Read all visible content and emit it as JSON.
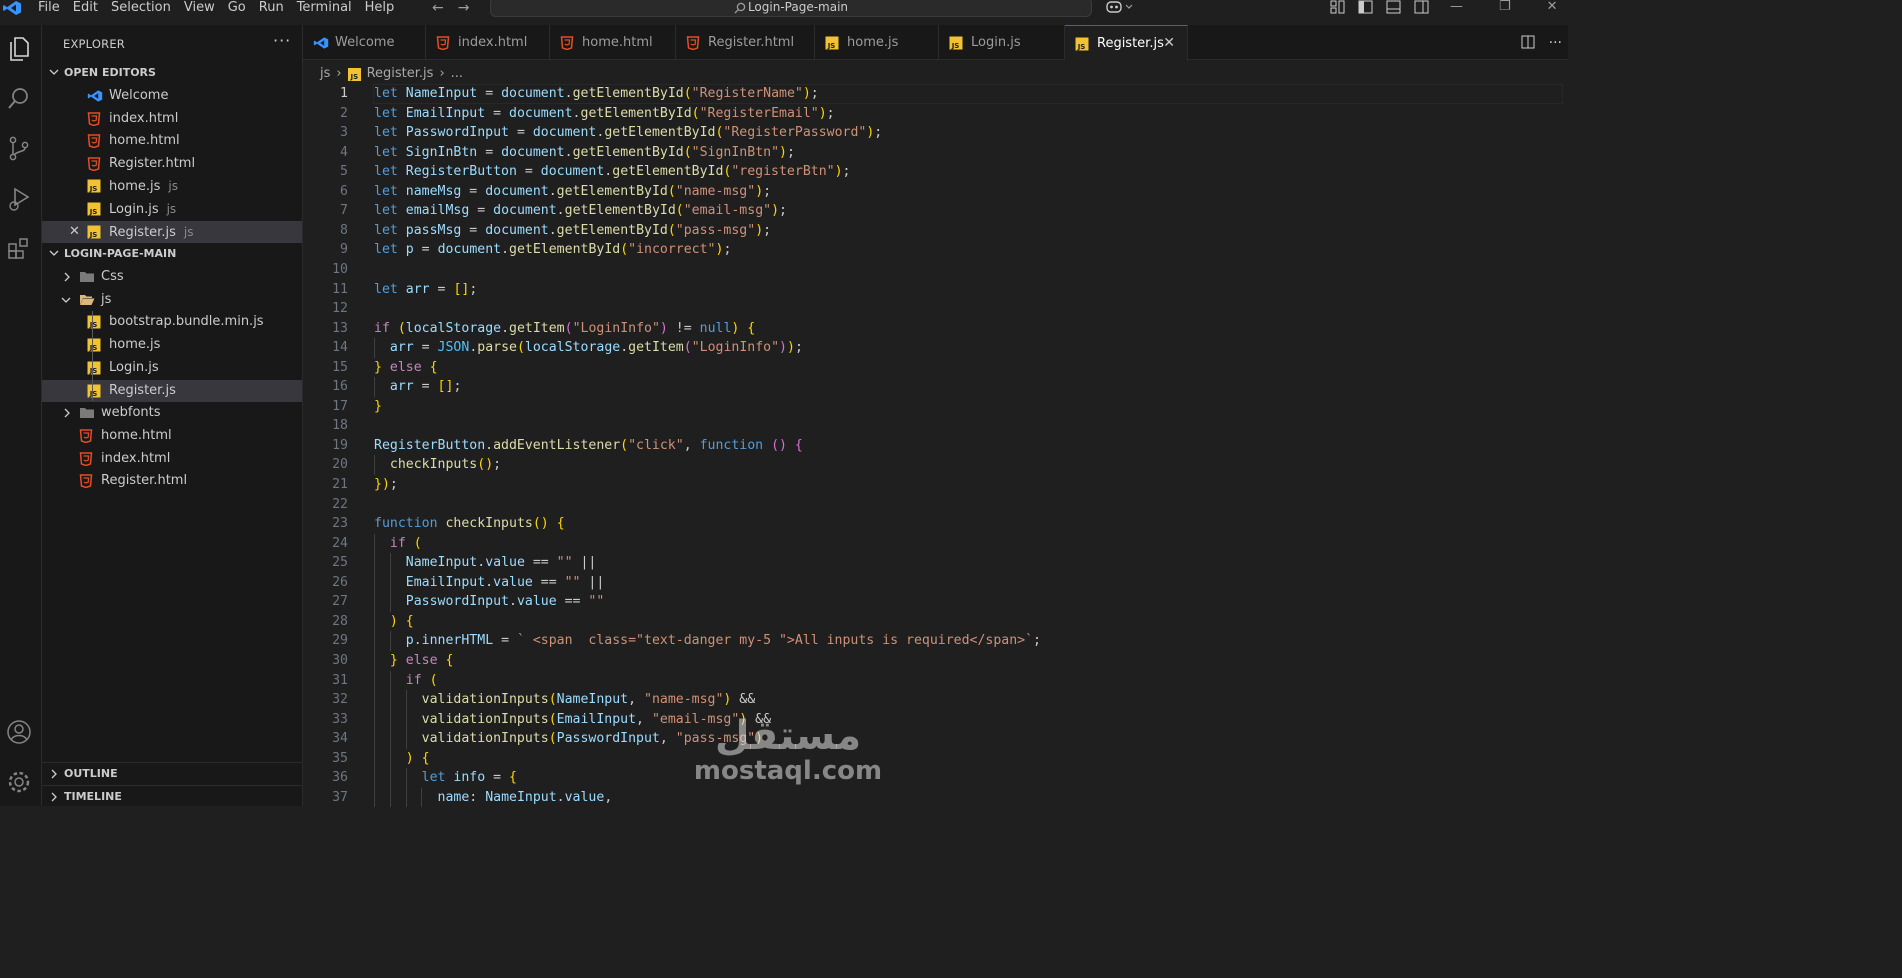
{
  "window": {
    "title": "Login-Page-main"
  },
  "menu": [
    "File",
    "Edit",
    "Selection",
    "View",
    "Go",
    "Run",
    "Terminal",
    "Help"
  ],
  "colors": {
    "accent": "#0078d4",
    "html_icon": "#e44d26",
    "js_icon": "#f1c232",
    "vscode_icon": "#3794ff",
    "folder": "#dcb67a"
  },
  "explorer": {
    "header": "EXPLORER",
    "open_editors": {
      "label": "OPEN EDITORS",
      "items": [
        {
          "name": "Welcome",
          "icon": "vscode-icon",
          "sub": ""
        },
        {
          "name": "index.html",
          "icon": "html-file-icon",
          "sub": ""
        },
        {
          "name": "home.html",
          "icon": "html-file-icon",
          "sub": ""
        },
        {
          "name": "Register.html",
          "icon": "html-file-icon",
          "sub": ""
        },
        {
          "name": "home.js",
          "icon": "js-file-icon",
          "sub": "js"
        },
        {
          "name": "Login.js",
          "icon": "js-file-icon",
          "sub": "js"
        },
        {
          "name": "Register.js",
          "icon": "js-file-icon",
          "sub": "js",
          "selected": true
        }
      ]
    },
    "project": {
      "label": "LOGIN-PAGE-MAIN",
      "items": [
        {
          "name": "Css",
          "type": "folder"
        },
        {
          "name": "js",
          "type": "folder-open"
        },
        {
          "name": "bootstrap.bundle.min.js",
          "type": "js"
        },
        {
          "name": "home.js",
          "type": "js"
        },
        {
          "name": "Login.js",
          "type": "js"
        },
        {
          "name": "Register.js",
          "type": "js",
          "selected": true
        },
        {
          "name": "webfonts",
          "type": "folder"
        },
        {
          "name": "home.html",
          "type": "html"
        },
        {
          "name": "index.html",
          "type": "html"
        },
        {
          "name": "Register.html",
          "type": "html"
        }
      ]
    },
    "outline_label": "OUTLINE",
    "timeline_label": "TIMELINE"
  },
  "tabs": [
    {
      "name": "Welcome",
      "icon": "vscode-icon"
    },
    {
      "name": "index.html",
      "icon": "html-file-icon"
    },
    {
      "name": "home.html",
      "icon": "html-file-icon"
    },
    {
      "name": "Register.html",
      "icon": "html-file-icon"
    },
    {
      "name": "home.js",
      "icon": "js-file-icon"
    },
    {
      "name": "Login.js",
      "icon": "js-file-icon"
    },
    {
      "name": "Register.js",
      "icon": "js-file-icon",
      "active": true
    }
  ],
  "breadcrumb": {
    "folder": "js",
    "file": "Register.js",
    "more": "..."
  },
  "editor": {
    "current_line": 1,
    "lines": [
      "let NameInput = document.getElementById(\"RegisterName\");",
      "let EmailInput = document.getElementById(\"RegisterEmail\");",
      "let PasswordInput = document.getElementById(\"RegisterPassword\");",
      "let SignInBtn = document.getElementById(\"SignInBtn\");",
      "let RegisterButton = document.getElementById(\"registerBtn\");",
      "let nameMsg = document.getElementById(\"name-msg\");",
      "let emailMsg = document.getElementById(\"email-msg\");",
      "let passMsg = document.getElementById(\"pass-msg\");",
      "let p = document.getElementById(\"incorrect\");",
      "",
      "let arr = [];",
      "",
      "if (localStorage.getItem(\"LoginInfo\") != null) {",
      "  arr = JSON.parse(localStorage.getItem(\"LoginInfo\"));",
      "} else {",
      "  arr = [];",
      "}",
      "",
      "RegisterButton.addEventListener(\"click\", function () {",
      "  checkInputs();",
      "});",
      "",
      "function checkInputs() {",
      "  if (",
      "    NameInput.value == \"\" ||",
      "    EmailInput.value == \"\" ||",
      "    PasswordInput.value == \"\"",
      "  ) {",
      "    p.innerHTML = ` <span  class=\"text-danger my-5 \">All inputs is required</span>`;",
      "  } else {",
      "    if (",
      "      validationInputs(NameInput, \"name-msg\") &&",
      "      validationInputs(EmailInput, \"email-msg\") &&",
      "      validationInputs(PasswordInput, \"pass-msg\")",
      "    ) {",
      "      let info = {",
      "        name: NameInput.value,"
    ]
  },
  "watermark": {
    "arabic": "مستقل",
    "latin": "mostaql.com"
  }
}
